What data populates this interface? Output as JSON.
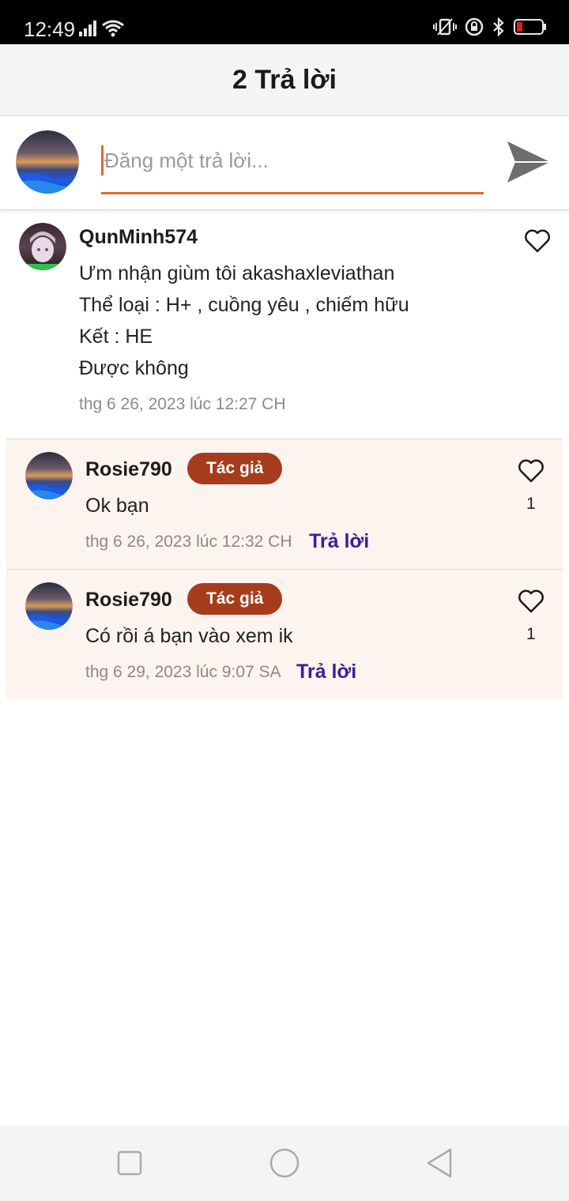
{
  "status_bar": {
    "time": "12:49",
    "icons": [
      "signal-icon",
      "wifi-icon",
      "vibrate-icon",
      "rotation-lock-icon",
      "bluetooth-icon",
      "battery-icon"
    ],
    "battery_color": "#e01e1e"
  },
  "header": {
    "title": "2 Trả lời"
  },
  "compose": {
    "placeholder": "Đăng một trả lời...",
    "accent_color": "#e06a2b",
    "send_icon": "send-icon"
  },
  "main_comment": {
    "author": "QunMinh574",
    "lines": [
      "Ưm nhận giùm tôi akashaxleviathan",
      "Thể loại : H+ , cuồng yêu , chiếm hữu",
      "Kết : HE",
      "Được không"
    ],
    "timestamp": "thg 6 26, 2023 lúc 12:27 CH"
  },
  "replies": [
    {
      "author": "Rosie790",
      "badge": "Tác giả",
      "text": "Ok bạn",
      "timestamp": "thg 6 26, 2023 lúc 12:32 CH",
      "reply_label": "Trả lời",
      "like_count": "1"
    },
    {
      "author": "Rosie790",
      "badge": "Tác giả",
      "text": "Có rồi á bạn vào xem ik",
      "timestamp": "thg 6 29, 2023 lúc 9:07 SA",
      "reply_label": "Trả lời",
      "like_count": "1"
    }
  ],
  "colors": {
    "badge": "#a73c1c",
    "reply_link": "#3a1f9e",
    "reply_bg": "#fdf3ef"
  },
  "nav_bar": {
    "icons": [
      "recents-icon",
      "home-icon",
      "back-icon"
    ]
  }
}
